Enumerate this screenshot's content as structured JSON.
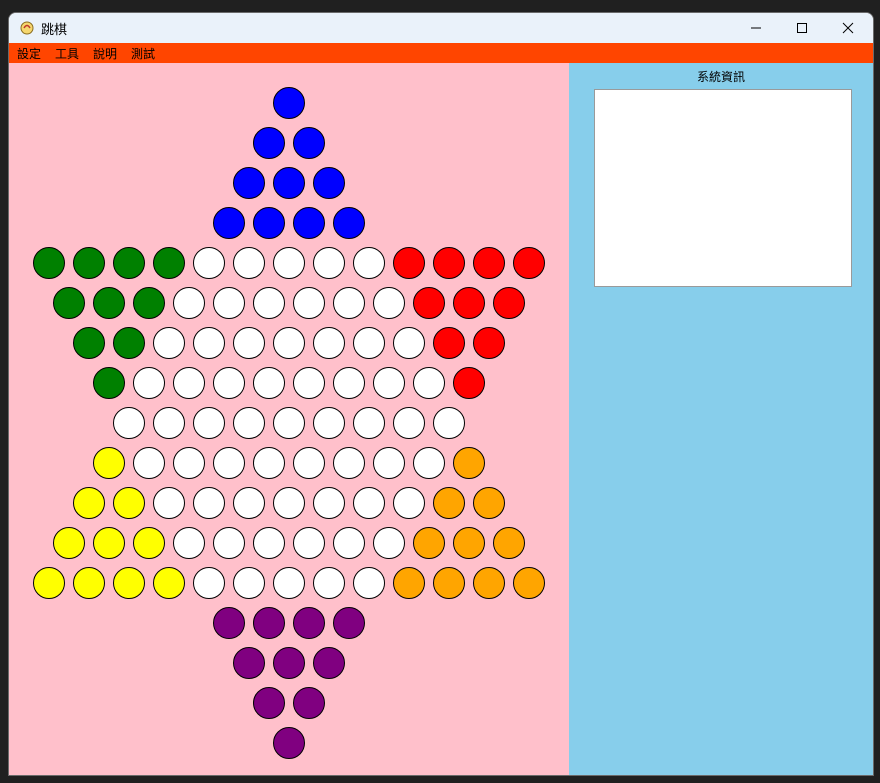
{
  "window": {
    "title": "跳棋",
    "controls": [
      "minimize-icon",
      "maximize-icon",
      "close-icon"
    ]
  },
  "menu": {
    "items": [
      {
        "label": "設定"
      },
      {
        "label": "工具"
      },
      {
        "label": "說明"
      },
      {
        "label": "測試"
      }
    ]
  },
  "colors": {
    "board_bg": "#ffc0cb",
    "panel_bg": "#87ceeb",
    "menu_bg": "#ff4500",
    "blue": "#0000ff",
    "green": "#008000",
    "red": "#ff0000",
    "yellow": "#ffff00",
    "orange": "#ffa500",
    "purple": "#800080",
    "empty": "#ffffff"
  },
  "info_panel": {
    "title": "系統資訊",
    "content": ""
  },
  "board": {
    "legend": "B=blue, G=green, R=red, Y=yellow, O=orange, P=purple, E=empty",
    "rows": [
      "B",
      "BB",
      "BBB",
      "BBBB",
      "GGGGEEEEERRRR",
      "GGGEEEEEERRR",
      "GGEEEEEEERR",
      "GEEEEEEEER",
      "EEEEEEEEE",
      "YEEEEEEEEO",
      "YYEEEEEEEOO",
      "YYYEEEEEEOOO",
      "YYYYEEEEEOOOO",
      "PPPP",
      "PPP",
      "PP",
      "P"
    ]
  }
}
